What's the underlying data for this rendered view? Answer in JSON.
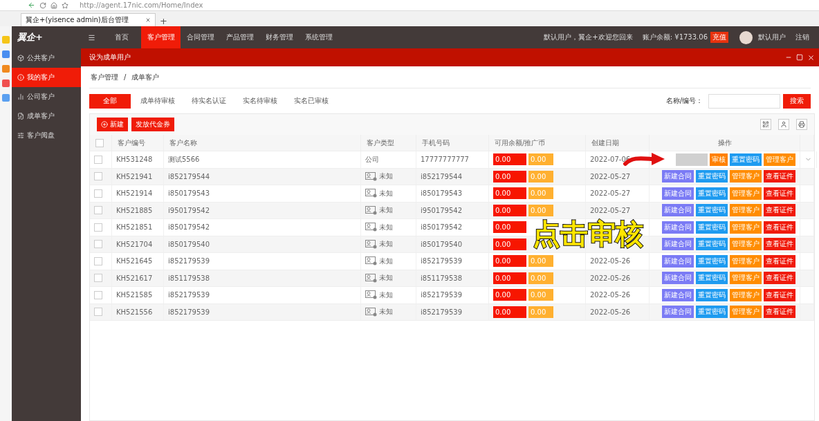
{
  "browser": {
    "url": "http://agent.17nic.com/Home/Index",
    "tab_title": "翼企+(yisence admin)后台管理",
    "new_tab": "+"
  },
  "header": {
    "logo": "翼企+",
    "nav": [
      {
        "label": "首页",
        "selected": false
      },
      {
        "label": "客户管理",
        "selected": true
      },
      {
        "label": "合同管理",
        "selected": false
      },
      {
        "label": "产品管理",
        "selected": false
      },
      {
        "label": "财务管理",
        "selected": false
      },
      {
        "label": "系统管理",
        "selected": false
      }
    ],
    "welcome": "默认用户，翼企+欢迎您回来",
    "balance": "账户余额: ¥1733.06",
    "recharge": "充值",
    "user": "默认用户",
    "logout": "注销"
  },
  "sidebar": {
    "items": [
      {
        "label": "公共客户",
        "selected": false
      },
      {
        "label": "我的客户",
        "selected": true
      },
      {
        "label": "公司客户",
        "selected": false
      },
      {
        "label": "成单客户",
        "selected": false
      },
      {
        "label": "客户阅盘",
        "selected": false
      }
    ]
  },
  "panel": {
    "title": "设为成单用户",
    "breadcrumb": [
      "客户管理",
      "成单客户"
    ],
    "breadcrumb_separator": "/",
    "filters": [
      {
        "label": "全部",
        "selected": true
      },
      {
        "label": "成单待审核",
        "selected": false
      },
      {
        "label": "待实名认证",
        "selected": false
      },
      {
        "label": "实名待审核",
        "selected": false
      },
      {
        "label": "实名已审核",
        "selected": false
      }
    ],
    "search": {
      "label": "名称/编号：",
      "button": "搜索"
    },
    "toolbar": [
      "新建",
      "发放代金券"
    ],
    "table": {
      "columns": [
        "客户编号",
        "客户名称",
        "客户类型",
        "手机号码",
        "可用余额/推广币",
        "创建日期",
        "操作"
      ],
      "header_checked": false,
      "rows": [
        {
          "checked": false,
          "id": "KH531248",
          "name": "测试5566",
          "type": "公司",
          "kind": "plain",
          "phone": "17777777777",
          "balance": "0.00",
          "coins": "0.00",
          "date": "2022-07-06",
          "expandable": true,
          "actions": [
            {
              "kind": "blank"
            },
            {
              "label": "审核",
              "kind": "audit"
            },
            {
              "label": "重置密码",
              "kind": "reset"
            },
            {
              "label": "管理客户",
              "kind": "manage"
            }
          ]
        },
        {
          "checked": false,
          "id": "KH521941",
          "name": "i852179544",
          "type": "未知",
          "kind": "card",
          "phone": "i852179544",
          "balance": "0.00",
          "coins": "0.00",
          "date": "2022-05-27",
          "expandable": false,
          "actions": [
            {
              "label": "新建合同",
              "kind": "contract"
            },
            {
              "label": "重置密码",
              "kind": "reset"
            },
            {
              "label": "管理客户",
              "kind": "manage"
            },
            {
              "label": "查看证件",
              "kind": "view"
            }
          ]
        },
        {
          "checked": false,
          "id": "KH521914",
          "name": "i850179543",
          "type": "未知",
          "kind": "card",
          "phone": "i850179543",
          "balance": "0.00",
          "coins": "0.00",
          "date": "2022-05-27",
          "expandable": false,
          "actions": [
            {
              "label": "新建合同",
              "kind": "contract"
            },
            {
              "label": "重置密码",
              "kind": "reset"
            },
            {
              "label": "管理客户",
              "kind": "manage"
            },
            {
              "label": "查看证件",
              "kind": "view"
            }
          ]
        },
        {
          "checked": false,
          "id": "KH521885",
          "name": "i950179542",
          "type": "未知",
          "kind": "card",
          "phone": "i950179542",
          "balance": "0.00",
          "coins": "0.00",
          "date": "2022-05-27",
          "expandable": false,
          "actions": [
            {
              "label": "新建合同",
              "kind": "contract"
            },
            {
              "label": "重置密码",
              "kind": "reset"
            },
            {
              "label": "管理客户",
              "kind": "manage"
            },
            {
              "label": "查看证件",
              "kind": "view"
            }
          ]
        },
        {
          "checked": false,
          "id": "KH521851",
          "name": "i850179542",
          "type": "未知",
          "kind": "card",
          "phone": "i850179542",
          "balance": "0.00",
          "expandable": false,
          "actions": [
            {
              "label": "新建合同",
              "kind": "contract"
            },
            {
              "label": "重置密码",
              "kind": "reset"
            },
            {
              "label": "管理客户",
              "kind": "manage"
            },
            {
              "label": "查看证件",
              "kind": "view"
            }
          ]
        },
        {
          "checked": false,
          "id": "KH521704",
          "name": "i850179540",
          "type": "未知",
          "kind": "card",
          "phone": "i850179540",
          "balance": "0.00",
          "expandable": false,
          "actions": [
            {
              "label": "新建合同",
              "kind": "contract"
            },
            {
              "label": "重置密码",
              "kind": "reset"
            },
            {
              "label": "管理客户",
              "kind": "manage"
            },
            {
              "label": "查看证件",
              "kind": "view"
            }
          ]
        },
        {
          "checked": false,
          "id": "KH521645",
          "name": "i852179539",
          "type": "未知",
          "kind": "card",
          "phone": "i852179539",
          "balance": "0.00",
          "coins": "0.00",
          "date": "2022-05-26",
          "expandable": false,
          "actions": [
            {
              "label": "新建合同",
              "kind": "contract"
            },
            {
              "label": "重置密码",
              "kind": "reset"
            },
            {
              "label": "管理客户",
              "kind": "manage"
            },
            {
              "label": "查看证件",
              "kind": "view"
            }
          ]
        },
        {
          "checked": false,
          "id": "KH521617",
          "name": "i851179538",
          "type": "未知",
          "kind": "card",
          "phone": "i851179538",
          "balance": "0.00",
          "coins": "0.00",
          "date": "2022-05-26",
          "expandable": false,
          "actions": [
            {
              "label": "新建合同",
              "kind": "contract"
            },
            {
              "label": "重置密码",
              "kind": "reset"
            },
            {
              "label": "管理客户",
              "kind": "manage"
            },
            {
              "label": "查看证件",
              "kind": "view"
            }
          ]
        },
        {
          "checked": false,
          "id": "KH521585",
          "name": "i852179539",
          "type": "未知",
          "kind": "card",
          "phone": "i852179539",
          "balance": "0.00",
          "coins": "0.00",
          "date": "2022-05-26",
          "expandable": false,
          "actions": [
            {
              "label": "新建合同",
              "kind": "contract"
            },
            {
              "label": "重置密码",
              "kind": "reset"
            },
            {
              "label": "管理客户",
              "kind": "manage"
            },
            {
              "label": "查看证件",
              "kind": "view"
            }
          ]
        },
        {
          "checked": false,
          "id": "KH521556",
          "name": "i852179539",
          "type": "未知",
          "kind": "card",
          "phone": "i852179539",
          "balance": "0.00",
          "coins": "0.00",
          "date": "2022-05-26",
          "expandable": false,
          "actions": [
            {
              "label": "新建合同",
              "kind": "contract"
            },
            {
              "label": "重置密码",
              "kind": "reset"
            },
            {
              "label": "管理客户",
              "kind": "manage"
            },
            {
              "label": "查看证件",
              "kind": "view"
            }
          ]
        }
      ]
    }
  },
  "caption": "点击审核"
}
